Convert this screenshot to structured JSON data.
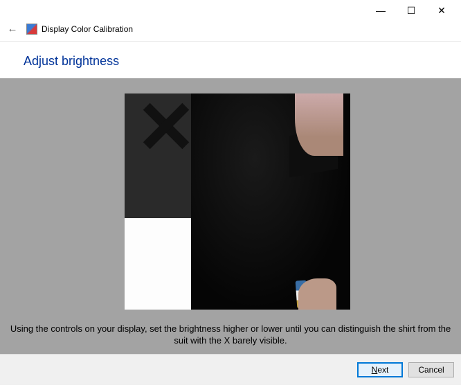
{
  "window": {
    "minimize_glyph": "—",
    "maximize_glyph": "☐",
    "close_glyph": "✕"
  },
  "header": {
    "back_glyph": "←",
    "title": "Display Color Calibration"
  },
  "page": {
    "heading": "Adjust brightness",
    "instruction": "Using the controls on your display, set the brightness higher or lower until you can distinguish the shirt from the suit with the X barely visible."
  },
  "footer": {
    "next_prefix": "N",
    "next_rest": "ext",
    "cancel_label": "Cancel"
  }
}
